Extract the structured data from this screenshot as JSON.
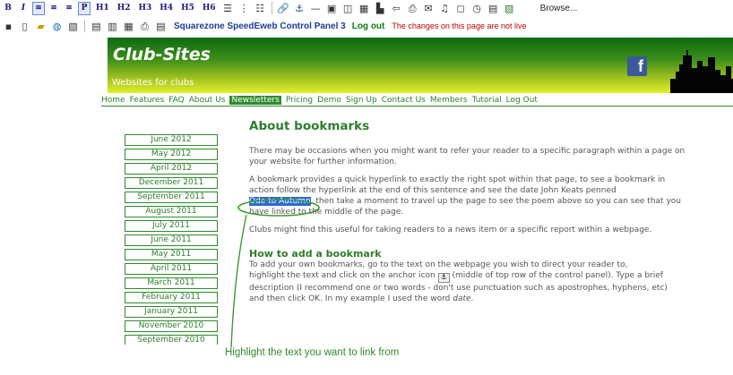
{
  "toolbar1": {
    "buttons": [
      "B",
      "I",
      "P",
      "H1",
      "H2",
      "H3",
      "H4",
      "H5",
      "H6"
    ],
    "browse_label": "Browse..."
  },
  "toolbar2": {
    "panel_title": "Squarezone SpeedEweb Control Panel 3",
    "logout_label": "Log out",
    "notice": "The changes on this page are not live"
  },
  "banner": {
    "title": "Club-Sites",
    "subtitle": "Websites for clubs",
    "fb_letter": "f"
  },
  "nav": [
    "Home",
    "Features",
    "FAQ",
    "About Us",
    "Newsletters",
    "Pricing",
    "Demo",
    "Sign Up",
    "Contact Us",
    "Members",
    "Tutorial",
    "Log Out"
  ],
  "nav_active": "Newsletters",
  "sidebar": [
    "June 2012",
    "May 2012",
    "April 2012",
    "December 2011",
    "September 2011",
    "August 2011",
    "July 2011",
    "June 2011",
    "May 2011",
    "April 2011",
    "March 2011",
    "February 2011",
    "January 2011",
    "November 2010",
    "September 2010"
  ],
  "content": {
    "heading": "About bookmarks",
    "p1a": "There may be occasions when you might want to refer your reader to a specific paragraph within a page on",
    "p1b": "your website for further information.",
    "p2a": "A bookmark provides a quick hyperlink to exactly the right spot within that page, to see a bookmark in",
    "p2b": "action follow the hyperlink at the end of this sentence and see the date John Keats penned",
    "p2_selected": "Ode to Autumn",
    "p2c": ", then take a moment to travel up the page to see the poem above so you can see that you",
    "p2d": "have linked to the middle of the page.",
    "p3": "Clubs might find this useful for taking readers to a news item or a specific report within a webpage.",
    "subheading": "How to add a bookmark",
    "p4a": "To add your own bookmarks, go to the text on the webpage you wish to direct your reader to,",
    "p4b_pre": "highlight the text and click on the anchor icon",
    "p4b_post": "(middle of top row of the control panel).  Type a brief",
    "p4c": "description (I recommend one or two words - don't use punctuation such as apostrophes, hyphens, etc)",
    "p4d_pre": "and then click OK. In my example I used the word",
    "p4d_em": "date",
    "p4d_post": "."
  },
  "annotation": "Highlight the text you want to link from"
}
